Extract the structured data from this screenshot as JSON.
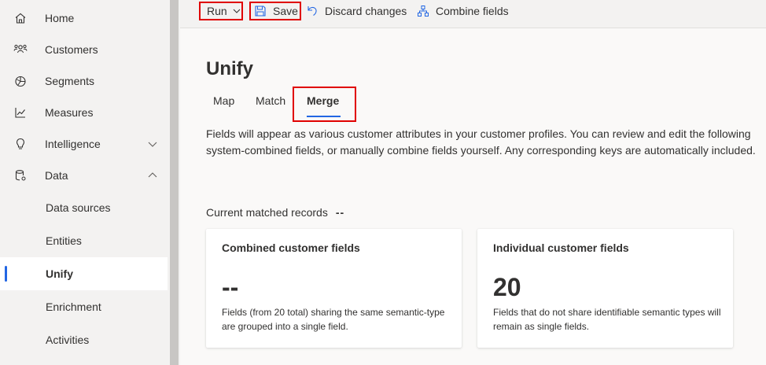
{
  "sidebar": {
    "items": [
      {
        "label": "Home",
        "icon": "home-icon"
      },
      {
        "label": "Customers",
        "icon": "customers-icon"
      },
      {
        "label": "Segments",
        "icon": "segments-icon"
      },
      {
        "label": "Measures",
        "icon": "measures-icon"
      },
      {
        "label": "Intelligence",
        "icon": "intelligence-icon",
        "expandable": "collapsed"
      },
      {
        "label": "Data",
        "icon": "data-icon",
        "expandable": "expanded"
      }
    ],
    "sub_items": [
      {
        "label": "Data sources"
      },
      {
        "label": "Entities"
      },
      {
        "label": "Unify",
        "selected": true
      },
      {
        "label": "Enrichment"
      },
      {
        "label": "Activities"
      }
    ]
  },
  "toolbar": {
    "run_label": "Run",
    "save_label": "Save",
    "discard_label": "Discard changes",
    "combine_label": "Combine fields"
  },
  "main": {
    "title": "Unify",
    "tabs": [
      {
        "label": "Map"
      },
      {
        "label": "Match"
      },
      {
        "label": "Merge",
        "active": true
      }
    ],
    "description": "Fields will appear as various customer attributes in your customer profiles. You can review and edit the following system-combined fields, or manually combine fields yourself. Any corresponding keys are automatically included.",
    "matched_label": "Current matched records",
    "matched_value": "--",
    "cards": [
      {
        "title": "Combined customer fields",
        "value": "--",
        "description": "Fields (from 20 total) sharing the same semantic-type are grouped into a single field."
      },
      {
        "title": "Individual customer fields",
        "value": "20",
        "description": "Fields that do not share identifiable semantic types will remain as single fields."
      }
    ]
  },
  "colors": {
    "accent": "#2266e3",
    "highlight": "#e00000"
  }
}
